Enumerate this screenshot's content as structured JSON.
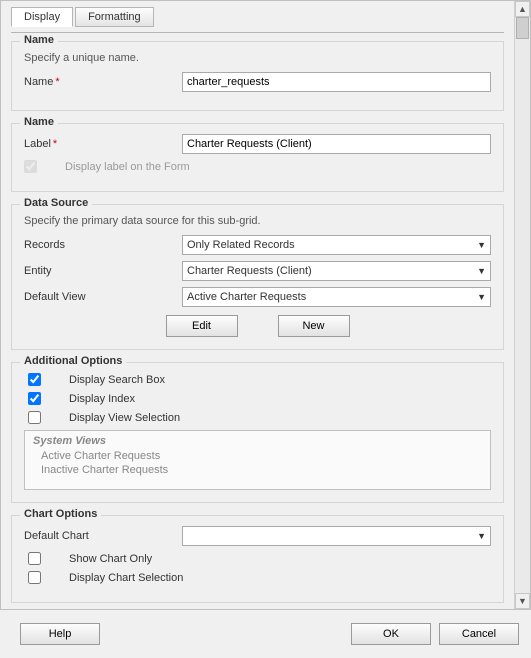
{
  "tabs": {
    "display": "Display",
    "formatting": "Formatting"
  },
  "name_group": {
    "legend": "Name",
    "desc": "Specify a unique name.",
    "label": "Name",
    "value": "charter_requests"
  },
  "label_group": {
    "legend": "Name",
    "label_field": "Label",
    "label_value": "Charter Requests (Client)",
    "display_label_text": "Display label on the Form"
  },
  "datasource": {
    "legend": "Data Source",
    "desc": "Specify the primary data source for this sub-grid.",
    "records_label": "Records",
    "records_value": "Only Related Records",
    "entity_label": "Entity",
    "entity_value": "Charter Requests (Client)",
    "defaultview_label": "Default View",
    "defaultview_value": "Active Charter Requests",
    "edit_btn": "Edit",
    "new_btn": "New"
  },
  "additional": {
    "legend": "Additional Options",
    "search": "Display Search Box",
    "index": "Display Index",
    "viewsel": "Display View Selection",
    "sysviews_hdr": "System Views",
    "sysviews": [
      "Active Charter Requests",
      "Inactive Charter Requests"
    ]
  },
  "chartopts": {
    "legend": "Chart Options",
    "defaultchart_label": "Default Chart",
    "defaultchart_value": "",
    "showchartonly": "Show Chart Only",
    "chartsel": "Display Chart Selection"
  },
  "buttons": {
    "help": "Help",
    "ok": "OK",
    "cancel": "Cancel"
  }
}
